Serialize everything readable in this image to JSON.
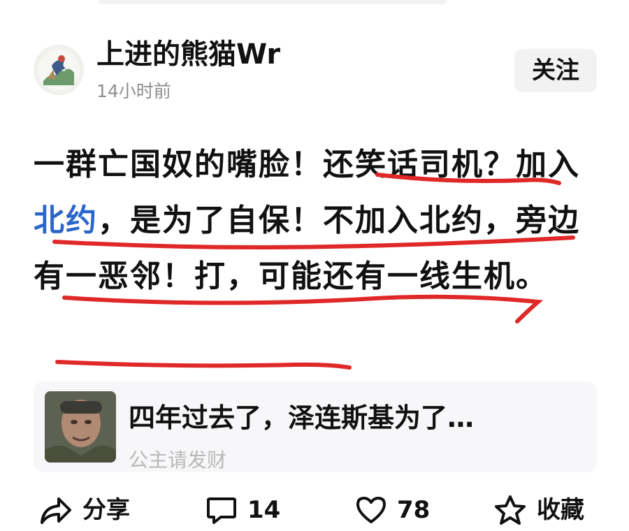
{
  "post": {
    "author_name": "上进的熊猫Wr",
    "time": "14小时前",
    "follow_label": "关注",
    "content": {
      "text_1": "一群亡国奴的嘴脸！还笑话司机？加入",
      "hashtag": "北约",
      "text_2": "，是为了自保！不加入北约，旁边有一恶邻！打，可能还有一线生机。"
    },
    "annotation_color": "#e02828"
  },
  "quoted_card": {
    "title": "四年过去了，泽连斯基为了…",
    "author": "公主请发财"
  },
  "actions": {
    "share_label": "分享",
    "comments_count": "14",
    "likes_count": "78",
    "favorite_label": "收藏"
  },
  "colors": {
    "text": "#111111",
    "meta": "#8e8e8e",
    "hashtag": "#2a66c9",
    "follow_bg": "#f2f2f2",
    "card_bg": "#f7f7f9"
  },
  "icons": {
    "share": "share-icon",
    "comment": "comment-icon",
    "like": "heart-icon",
    "favorite": "star-icon"
  }
}
